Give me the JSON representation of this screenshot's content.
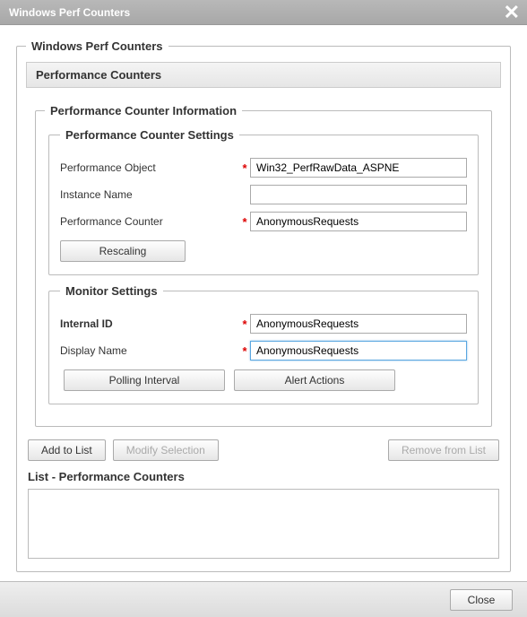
{
  "window": {
    "title": "Windows Perf Counters"
  },
  "outer": {
    "legend": "Windows Perf Counters",
    "section_header": "Performance Counters",
    "info_legend": "Performance Counter Information",
    "settings_legend": "Performance Counter Settings",
    "monitor_legend": "Monitor Settings"
  },
  "settings": {
    "perf_object_label": "Performance Object",
    "perf_object_value": "Win32_PerfRawData_ASPNE",
    "instance_name_label": "Instance Name",
    "instance_name_value": "",
    "perf_counter_label": "Performance Counter",
    "perf_counter_value": "AnonymousRequests",
    "rescaling_btn": "Rescaling"
  },
  "monitor": {
    "internal_id_label": "Internal ID",
    "internal_id_value": "AnonymousRequests",
    "display_name_label": "Display Name",
    "display_name_value": "AnonymousRequests",
    "polling_btn": "Polling Interval",
    "alert_btn": "Alert Actions"
  },
  "actions": {
    "add": "Add to List",
    "modify": "Modify Selection",
    "remove": "Remove from List"
  },
  "list": {
    "title": "List - Performance Counters"
  },
  "footer": {
    "close": "Close"
  },
  "asterisk": "*"
}
